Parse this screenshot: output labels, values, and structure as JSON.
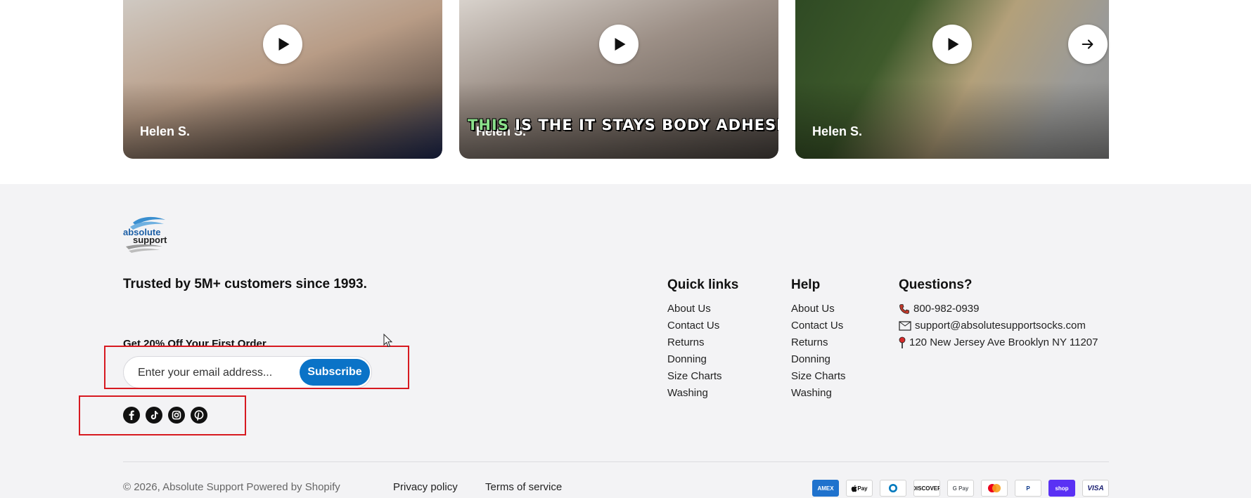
{
  "videos": {
    "cards": [
      {
        "name": "Helen S."
      },
      {
        "name": "Helen S.",
        "caption_highlight": "THIS",
        "caption_rest": " IS THE IT STAYS BODY ADHESIVE"
      },
      {
        "name": "Helen S."
      }
    ],
    "play_icon": "play-icon",
    "next_icon": "arrow-right-icon"
  },
  "footer": {
    "logo_text": "absolute support",
    "tagline": "Trusted by 5M+ customers since 1993.",
    "newsletter": {
      "title": "Get 20% Off Your First Order",
      "placeholder": "Enter your email address...",
      "button": "Subscribe"
    },
    "social": [
      "facebook-icon",
      "tiktok-icon",
      "instagram-icon",
      "pinterest-icon"
    ],
    "quick_links": {
      "title": "Quick links",
      "items": [
        "About Us",
        "Contact Us",
        "Returns",
        "Donning",
        "Size Charts",
        "Washing"
      ]
    },
    "help": {
      "title": "Help",
      "items": [
        "About Us",
        "Contact Us",
        "Returns",
        "Donning",
        "Size Charts",
        "Washing"
      ]
    },
    "questions": {
      "title": "Questions?",
      "phone": "800-982-0939",
      "email": "support@absolutesupportsocks.com",
      "address": "120 New Jersey Ave Brooklyn NY 11207"
    },
    "bottom": {
      "copyright": "© 2026, Absolute Support Powered by Shopify",
      "privacy": "Privacy policy",
      "terms": "Terms of service"
    },
    "payments": {
      "amex": "AMEX",
      "applepay": "Pay",
      "diners": "D",
      "discover": "DISCOVER",
      "gpay": "G Pay",
      "mastercard": "",
      "paypal": "P",
      "shoppay": "shop",
      "visa": "VISA"
    },
    "colors": {
      "accent": "#0a73c7",
      "highlight_box": "#d71920",
      "background": "#f3f3f5"
    }
  }
}
